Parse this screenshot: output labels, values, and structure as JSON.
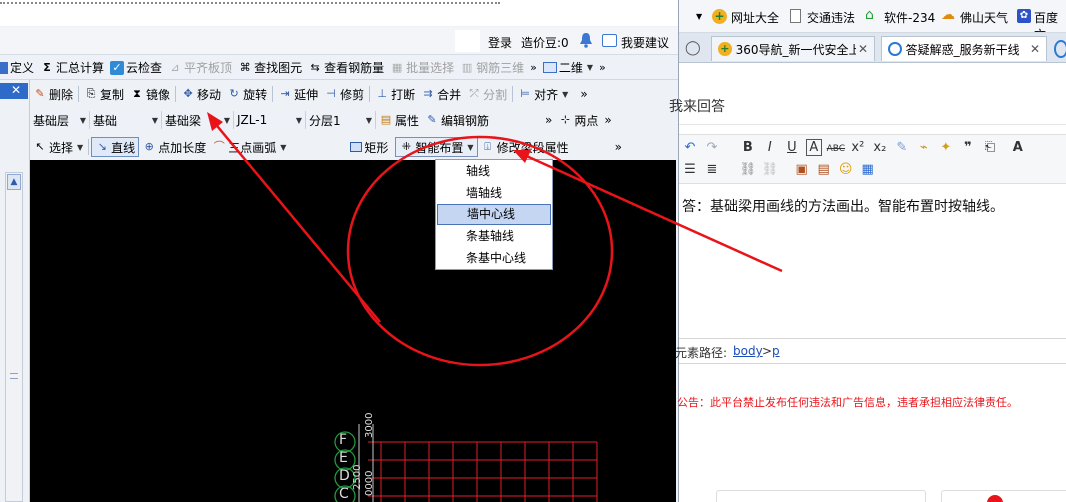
{
  "app": {
    "top_bar": {
      "login": "登录",
      "price_bean": "造价豆:0",
      "feedback": "我要建议"
    },
    "menu1": {
      "define": "定义",
      "summary": "汇总计算",
      "cloud_check": "云检查",
      "flat_slab": "平齐板顶",
      "find": "查找图元",
      "view_rebar": "查看钢筋量",
      "batch_select": "批量选择",
      "rebar_3d": "钢筋三维",
      "view_mode": "二维"
    },
    "toolbar2": {
      "delete": "删除",
      "copy": "复制",
      "mirror": "镜像",
      "move": "移动",
      "rotate": "旋转",
      "extend": "延伸",
      "trim": "修剪",
      "break": "打断",
      "merge": "合并",
      "split": "分割",
      "align": "对齐"
    },
    "toolbar3": {
      "layer": "基础层",
      "category": "基础",
      "element_type": "基础梁",
      "element": "JZL-1",
      "sublayer": "分层1",
      "property": "属性",
      "edit_rebar": "编辑钢筋",
      "two_points": "两点"
    },
    "toolbar4": {
      "select": "选择",
      "line": "直线",
      "point_length": "点加长度",
      "arc": "三点画弧",
      "rect": "矩形",
      "smart_layout": "智能布置",
      "modify_segment": "修改梁段属性"
    },
    "smart_layout_menu": [
      "轴线",
      "墙轴线",
      "墙中心线",
      "条基轴线",
      "条基中心线"
    ],
    "highlighted_item": "墙中心线",
    "grid_labels": [
      "F",
      "E",
      "D",
      "C"
    ],
    "grid_dim_labels": [
      "3000",
      "2500",
      "0000"
    ]
  },
  "browser": {
    "bookmarks": {
      "site_nav": "网址大全",
      "traffic": "交通违法",
      "software": "软件-234",
      "weather": "佛山天气",
      "baidu": "百度文"
    },
    "tabs": [
      "360导航_新一代安全上",
      "答疑解惑_服务新干线"
    ],
    "heading": "我来回答",
    "answer_text": "答：基础梁用画线的方法画出。智能布置时按轴线。",
    "path_label": "元素路径:",
    "path_body": "body",
    "path_sep": ">",
    "path_p": "p",
    "notice": "公告：此平台禁止发布任何违法和广告信息，违者承担相应法律责任。"
  },
  "colors": {
    "annotation_red": "#e8141a",
    "canvas": "#000000",
    "grid_red": "#e0202a",
    "grid_green": "#1e9b3c",
    "highlight": "#c5d6f2"
  }
}
